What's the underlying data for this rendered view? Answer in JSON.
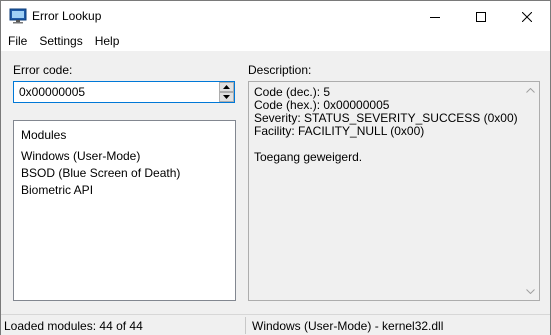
{
  "window": {
    "title": "Error Lookup",
    "app_icon": "monitor-icon"
  },
  "menu": [
    "File",
    "Settings",
    "Help"
  ],
  "error_code": {
    "label": "Error code:",
    "value": "0x00000005"
  },
  "modules": {
    "header": "Modules",
    "items": [
      "Windows (User-Mode)",
      "BSOD (Blue Screen of Death)",
      "Biometric API"
    ]
  },
  "description": {
    "label": "Description:",
    "lines": [
      "Code (dec.): 5",
      "Code (hex.): 0x00000005",
      "Severity: STATUS_SEVERITY_SUCCESS (0x00)",
      "Facility: FACILITY_NULL (0x00)",
      "",
      "Toegang geweigerd."
    ]
  },
  "status": {
    "left": "Loaded modules: 44 of 44",
    "right": "Windows (User-Mode) - kernel32.dll"
  },
  "colors": {
    "focus_border": "#0078d7",
    "titlebar_bg": "#ffffff",
    "window_bg": "#f0f0f0"
  }
}
